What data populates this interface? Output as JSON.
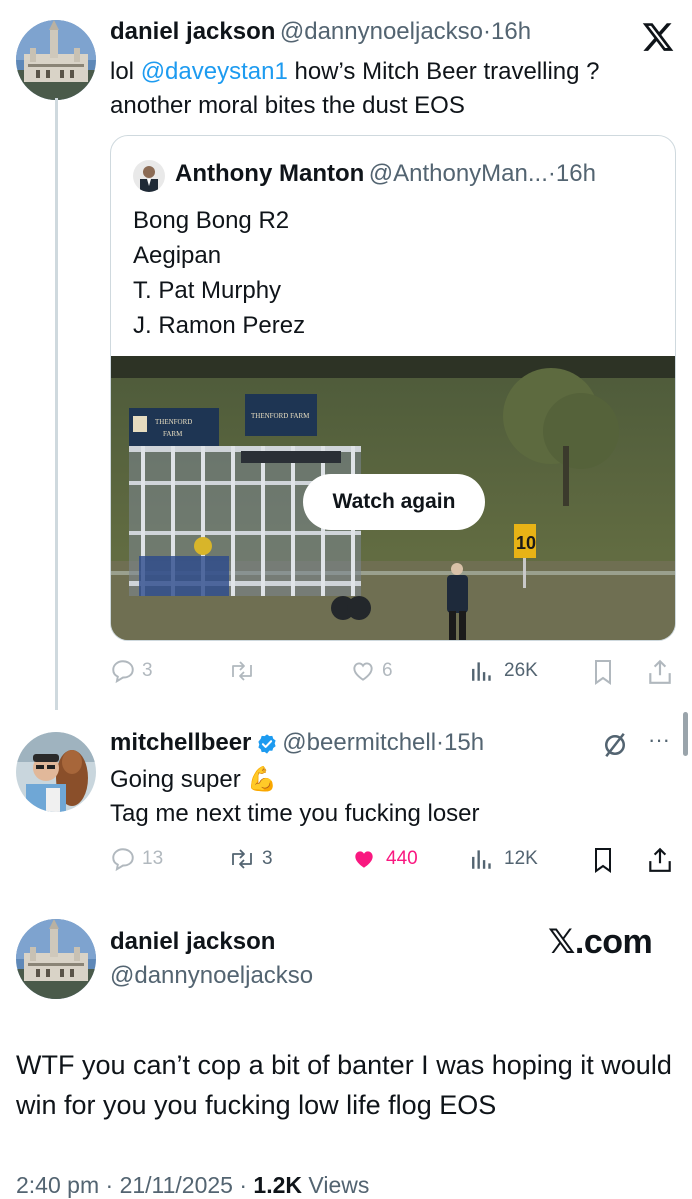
{
  "tweet1": {
    "name": "daniel jackson",
    "handle": "@dannynoeljackso",
    "sep": "·",
    "time": "16h",
    "text_pre": "lol ",
    "mention": "@daveystan1",
    "text_post": " how’s Mitch Beer travelling ?",
    "text_line2": "another moral bites the dust EOS",
    "x_logo": "X"
  },
  "quote": {
    "name": "Anthony Manton",
    "handle": "@AnthonyMan...",
    "sep": "·",
    "time": "16h",
    "lines": [
      "Bong Bong R2",
      "Aegipan",
      "T. Pat Murphy",
      "J. Ramon Perez"
    ],
    "watch_again": "Watch again",
    "sign_left_1": "THENFORD",
    "sign_left_2": "FARM",
    "sign_right": "THENFORD FARM",
    "marker": "10"
  },
  "actions1": {
    "replies": "3",
    "retweets": "",
    "likes": "6",
    "views": "26K"
  },
  "tweet2": {
    "name": "mitchellbeer",
    "handle": "@beermitchell",
    "sep": "·",
    "time": "15h",
    "line1": "Going super 💪",
    "line2": "Tag me next time you fucking loser",
    "more": "···"
  },
  "actions2": {
    "replies": "13",
    "retweets": "3",
    "likes": "440",
    "views": "12K"
  },
  "tweet3": {
    "name": "daniel jackson",
    "handle": "@dannynoeljackso",
    "brand": "𝕏.com",
    "text": "WTF you can’t cop a bit of banter I was hoping it would win for you you fucking low life flog EOS",
    "time": "2:40 pm",
    "sep1": "·",
    "date": "21/11/2025",
    "sep2": "·",
    "views_count": "1.2K",
    "views_label": "Views"
  },
  "colors": {
    "like_pink": "#f91880",
    "verified_blue": "#1d9bf0",
    "mention_blue": "#1d9bf0",
    "muted_gray": "#536471"
  }
}
